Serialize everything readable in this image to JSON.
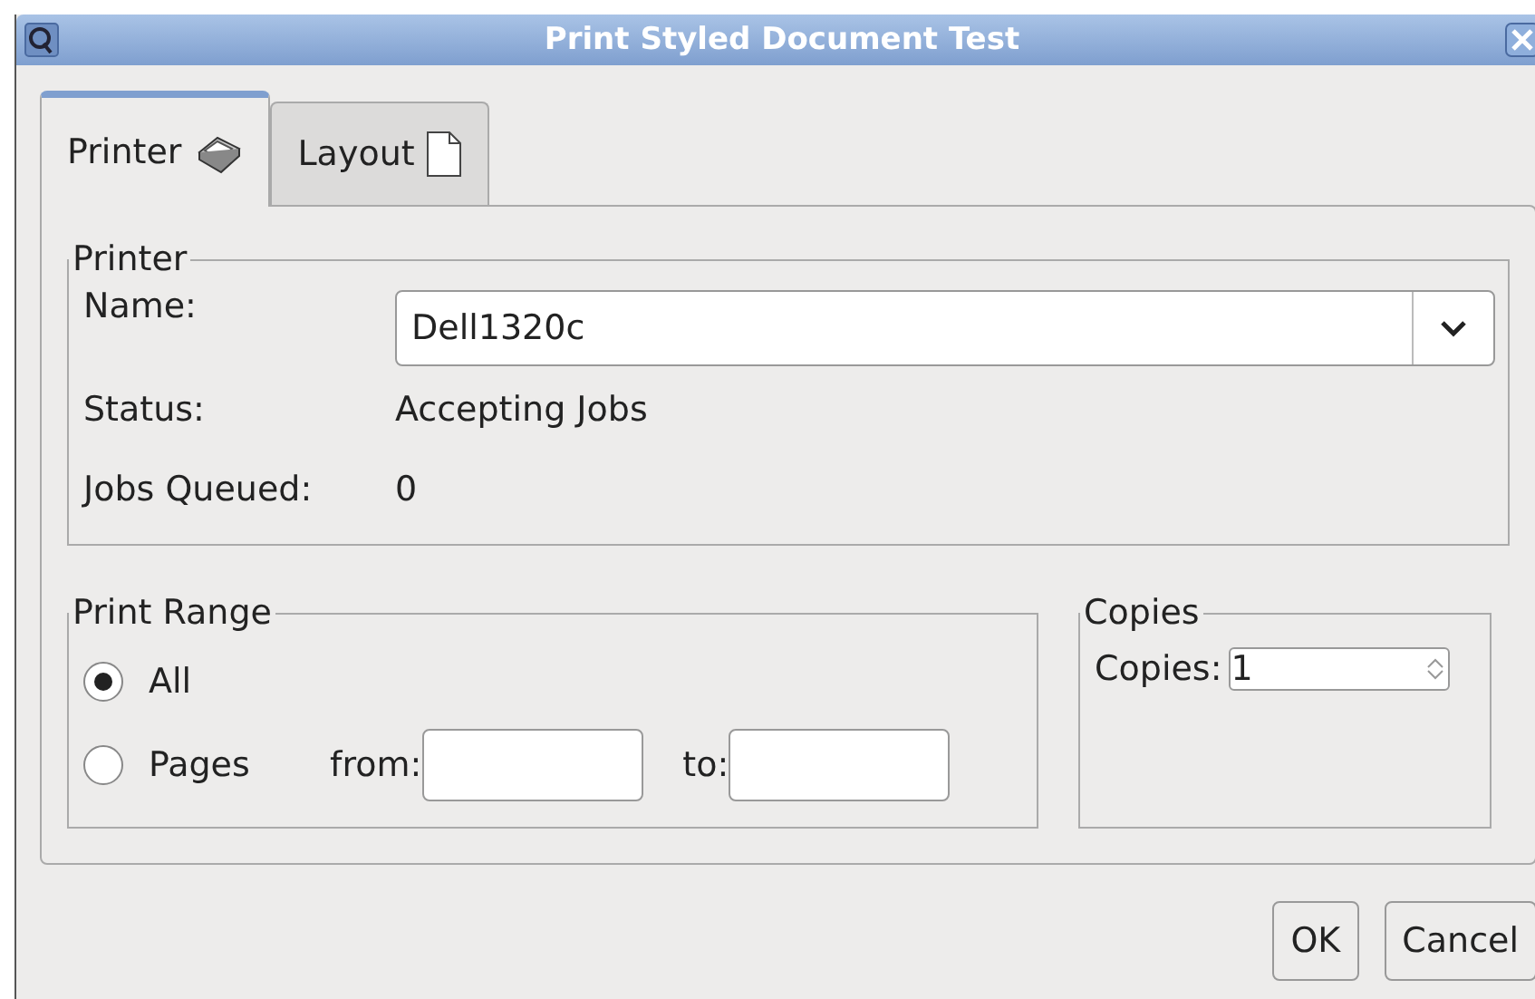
{
  "window": {
    "title": "Print Styled Document Test"
  },
  "tabs": [
    {
      "label": "Printer",
      "kind": "printer",
      "selected": true
    },
    {
      "label": "Layout",
      "kind": "page",
      "selected": false
    }
  ],
  "printer": {
    "title": "Printer",
    "name_label": "Name:",
    "name_value": "Dell1320c",
    "status_label": "Status:",
    "status_value": "Accepting Jobs",
    "queued_label": "Jobs Queued:",
    "queued_value": "0"
  },
  "print_range": {
    "title": "Print Range",
    "options": [
      {
        "label": "All",
        "selected": true
      },
      {
        "label": "Pages",
        "selected": false
      }
    ],
    "from_label": "from:",
    "to_label": "to:"
  },
  "copies": {
    "title": "Copies",
    "label": "Copies:",
    "value": "1"
  },
  "buttons": [
    "OK",
    "Cancel"
  ]
}
